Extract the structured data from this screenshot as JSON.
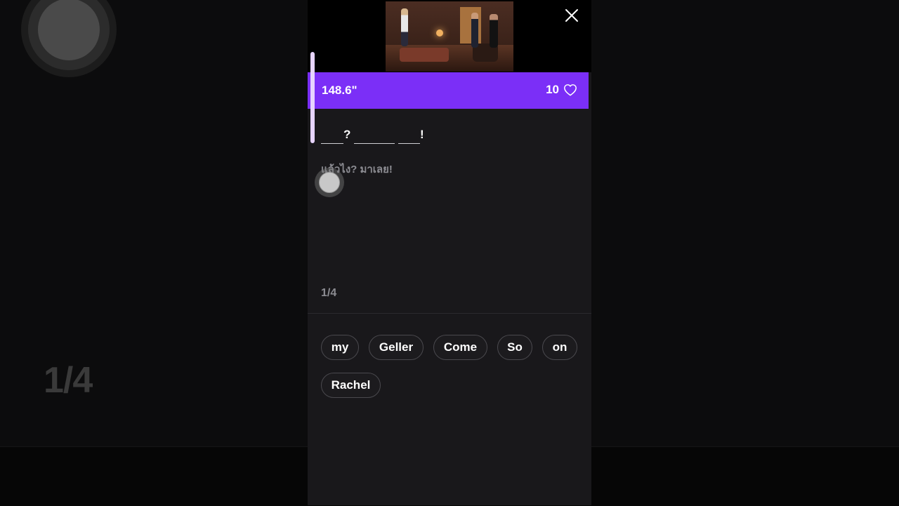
{
  "background": {
    "counter": "1/4"
  },
  "header": {
    "timer": "148.6\"",
    "lives": "10"
  },
  "sentence": {
    "punctuation": [
      "?",
      "!"
    ]
  },
  "translation": "แล้วไง? มาเลย!",
  "progress": "1/4",
  "word_bank": [
    "my",
    "Geller",
    "Come",
    "So",
    "on",
    "Rachel"
  ],
  "colors": {
    "accent": "#7b2ff7",
    "panel_bg": "#19181b",
    "muted_text": "#8c8c92"
  },
  "icons": {
    "close": "close-icon",
    "lives": "heart-icon"
  }
}
